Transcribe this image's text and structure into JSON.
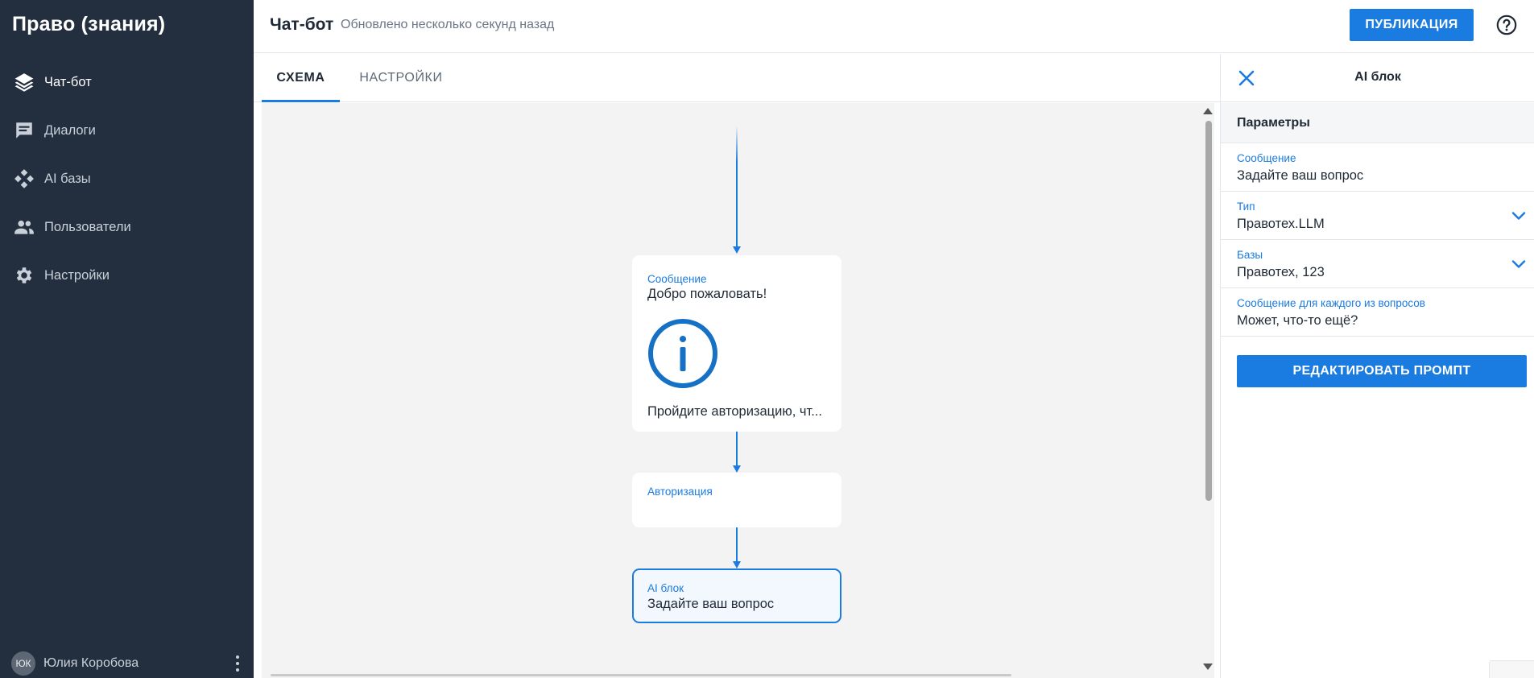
{
  "brand": {
    "title": "Право (знания)"
  },
  "sidebar": {
    "items": [
      {
        "label": "Чат-бот",
        "icon": "layers-icon",
        "active": true
      },
      {
        "label": "Диалоги",
        "icon": "chat-icon"
      },
      {
        "label": "AI базы",
        "icon": "diamond-grid-icon"
      },
      {
        "label": "Пользователи",
        "icon": "users-icon"
      },
      {
        "label": "Настройки",
        "icon": "gear-icon"
      }
    ],
    "user": {
      "initials": "ЮК",
      "name": "Юлия Коробова"
    }
  },
  "header": {
    "title": "Чат-бот",
    "updated": "Обновлено несколько секунд назад",
    "publish_label": "ПУБЛИКАЦИЯ"
  },
  "tabs": [
    {
      "label": "СХЕМА",
      "active": true
    },
    {
      "label": "НАСТРОЙКИ"
    }
  ],
  "flow": {
    "nodes": [
      {
        "type": "Сообщение",
        "title": "Добро пожаловать!",
        "icon": "info-circle-icon",
        "footer": "Пройдите авторизацию, чт..."
      },
      {
        "type": "Авторизация",
        "title": ""
      },
      {
        "type": "AI блок",
        "title": "Задайте ваш вопрос",
        "selected": true
      }
    ]
  },
  "panel": {
    "title": "AI блок",
    "section": "Параметры",
    "fields": [
      {
        "label": "Сообщение",
        "value": "Задайте ваш вопрос"
      },
      {
        "label": "Тип",
        "value": "Правотех.LLM",
        "dropdown": true
      },
      {
        "label": "Базы",
        "value": "Правотех, 123",
        "dropdown": true
      },
      {
        "label": "Сообщение для каждого из вопросов",
        "value": "Может, что-то ещё?"
      }
    ],
    "button_label": "РЕДАКТИРОВАТЬ ПРОМПТ"
  },
  "colors": {
    "accent": "#1a7be0",
    "sidebar_bg": "#232f3e",
    "canvas_bg": "#f3f3f3"
  }
}
